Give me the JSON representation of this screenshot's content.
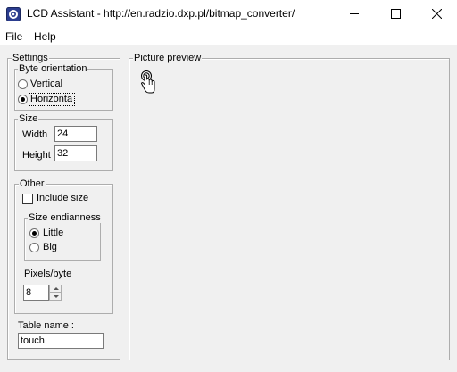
{
  "window": {
    "title": "LCD Assistant -  http://en.radzio.dxp.pl/bitmap_converter/",
    "icon": "lcd-assistant-app-icon"
  },
  "menu": {
    "items": [
      {
        "label": "File"
      },
      {
        "label": "Help"
      }
    ]
  },
  "settings": {
    "legend": "Settings",
    "byte_orientation": {
      "legend": "Byte orientation",
      "vertical_label": "Vertical",
      "horizontal_label": "Horizontal",
      "selected": "Horizontal"
    },
    "size": {
      "legend": "Size",
      "width_label": "Width",
      "width_value": "24",
      "height_label": "Height",
      "height_value": "32"
    },
    "other": {
      "legend": "Other",
      "include_size_label": "Include size",
      "include_size_checked": false,
      "endianness": {
        "legend": "Size endianness",
        "little_label": "Little",
        "big_label": "Big",
        "selected": "Little"
      },
      "pixels_per_byte_label": "Pixels/byte",
      "pixels_per_byte_value": "8"
    },
    "table_name_label": "Table name :",
    "table_name_value": "touch"
  },
  "preview": {
    "legend": "Picture preview",
    "image_icon": "touch-hand-icon"
  },
  "colors": {
    "window_bg": "#f0f0f0",
    "titlebar_bg": "#ffffff",
    "groupbox_border": "#adadad"
  }
}
